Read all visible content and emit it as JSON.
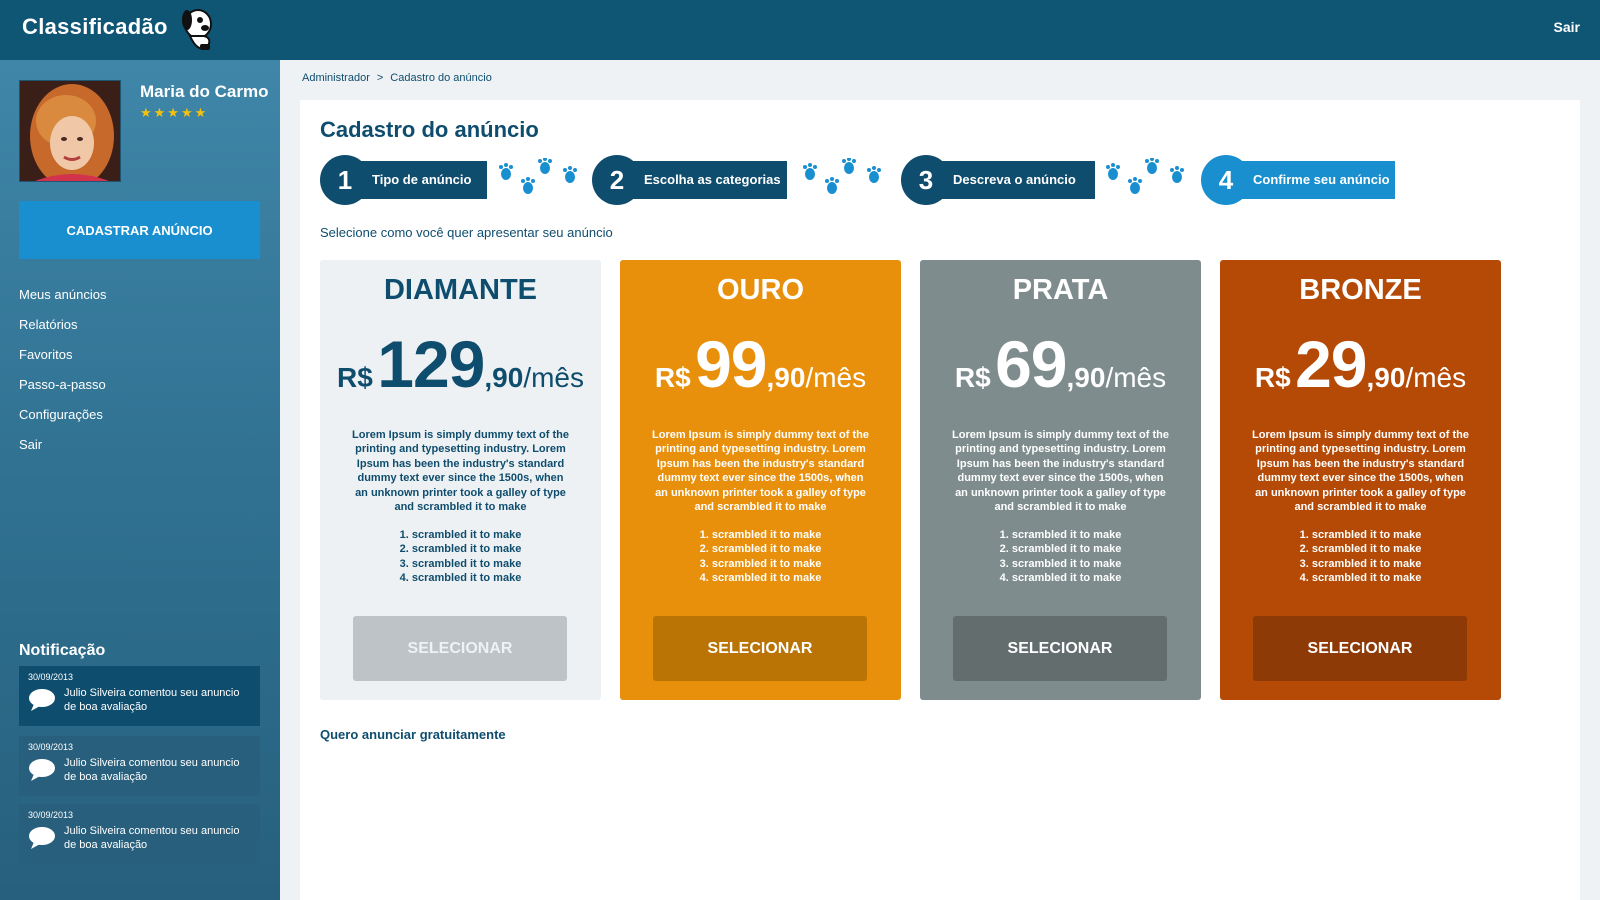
{
  "app": {
    "logo_text": "Classificadão",
    "exit_label": "Sair"
  },
  "user": {
    "name": "Maria do Carmo",
    "stars": "★★★★★"
  },
  "sidebar": {
    "cta_label": "CADASTRAR ANÚNCIO",
    "menu": [
      "Meus anúncios",
      "Relatórios",
      "Favoritos",
      "Passo-a-passo",
      "Configurações",
      "Sair"
    ],
    "notifications_title": "Notificação",
    "notifications": [
      {
        "date": "30/09/2013",
        "text": "Julio Silveira comentou seu anuncio de boa avaliação"
      },
      {
        "date": "30/09/2013",
        "text": "Julio Silveira comentou seu anuncio de boa avaliação"
      },
      {
        "date": "30/09/2013",
        "text": "Julio Silveira comentou seu anuncio de boa avaliação"
      }
    ]
  },
  "breadcrumb": {
    "items": [
      "Administrador",
      "Cadastro do anúncio"
    ],
    "separator": ">"
  },
  "page": {
    "title": "Cadastro do anúncio",
    "subtitle": "Selecione como você quer apresentar seu anúncio",
    "free_link": "Quero anunciar gratuitamente"
  },
  "steps": [
    {
      "number": "1",
      "label": "Tipo de anúncio"
    },
    {
      "number": "2",
      "label": "Escolha as categorias"
    },
    {
      "number": "3",
      "label": "Descreva o anúncio"
    },
    {
      "number": "4",
      "label": "Confirme seu anúncio"
    }
  ],
  "plans": [
    {
      "name": "DIAMANTE",
      "currency": "R$",
      "price_int": "129",
      "price_cents": ",90",
      "period": "/mês",
      "description": "Lorem Ipsum is simply dummy text of the printing and typesetting industry. Lorem Ipsum has been the industry's standard dummy text ever since the 1500s, when an unknown printer took a galley of type and scrambled it to make",
      "features": [
        "1. scrambled it to make",
        "2. scrambled it to make",
        "3. scrambled it to make",
        "4. scrambled it to make"
      ],
      "button": "SELECIONAR",
      "bg": "#edf1f3",
      "text_color": "#0f4d6e",
      "button_bg": "#bdc3c6",
      "button_color": "#eef2f4"
    },
    {
      "name": "OURO",
      "currency": "R$",
      "price_int": "99",
      "price_cents": ",90",
      "period": "/mês",
      "description": "Lorem Ipsum is simply dummy text of the printing and typesetting industry. Lorem Ipsum has been the industry's standard dummy text ever since the 1500s, when an unknown printer took a galley of type and scrambled it to make",
      "features": [
        "1. scrambled it to make",
        "2. scrambled it to make",
        "3. scrambled it to make",
        "4. scrambled it to make"
      ],
      "button": "SELECIONAR",
      "bg": "#e8900c",
      "text_color": "#ffffff",
      "button_bg": "#b97405",
      "button_color": "#ffffff"
    },
    {
      "name": "PRATA",
      "currency": "R$",
      "price_int": "69",
      "price_cents": ",90",
      "period": "/mês",
      "description": "Lorem Ipsum is simply dummy text of the printing and typesetting industry. Lorem Ipsum has been the industry's standard dummy text ever since the 1500s, when an unknown printer took a galley of type and scrambled it to make",
      "features": [
        "1. scrambled it to make",
        "2. scrambled it to make",
        "3. scrambled it to make",
        "4. scrambled it to make"
      ],
      "button": "SELECIONAR",
      "bg": "#7f8c8d",
      "text_color": "#ffffff",
      "button_bg": "#636d6e",
      "button_color": "#ffffff"
    },
    {
      "name": "BRONZE",
      "currency": "R$",
      "price_int": "29",
      "price_cents": ",90",
      "period": "/mês",
      "description": "Lorem Ipsum is simply dummy text of the printing and typesetting industry. Lorem Ipsum has been the industry's standard dummy text ever since the 1500s, when an unknown printer took a galley of type and scrambled it to make",
      "features": [
        "1. scrambled it to make",
        "2. scrambled it to make",
        "3. scrambled it to make",
        "4. scrambled it to make"
      ],
      "button": "SELECIONAR",
      "bg": "#b44a06",
      "text_color": "#ffffff",
      "button_bg": "#8d3a07",
      "button_color": "#ffffff"
    }
  ],
  "icons": {
    "logo": "dog-mascot-icon",
    "step_separator": "paw-prints-icon",
    "notification": "speech-bubble-icon"
  },
  "colors": {
    "navy": "#0f4d6e",
    "accent_blue": "#1a8fd0",
    "star": "#f4c20d"
  }
}
